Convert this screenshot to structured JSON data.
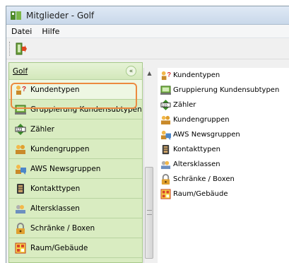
{
  "window": {
    "title": "Mitglieder - Golf"
  },
  "menu": {
    "items": [
      "Datei",
      "Hilfe"
    ]
  },
  "nav": {
    "header": "Golf",
    "items": [
      {
        "label": "Kundentypen",
        "icon": "kundentypen-icon"
      },
      {
        "label": "Gruppierung Kundensubtypen",
        "icon": "gruppierung-icon"
      },
      {
        "label": "Zähler",
        "icon": "zaehler-icon"
      },
      {
        "label": "Kundengruppen",
        "icon": "kundengruppen-icon"
      },
      {
        "label": "AWS Newsgruppen",
        "icon": "newsgruppen-icon"
      },
      {
        "label": "Kontakttypen",
        "icon": "kontakttypen-icon"
      },
      {
        "label": "Altersklassen",
        "icon": "altersklassen-icon"
      },
      {
        "label": "Schränke / Boxen",
        "icon": "schraenke-icon"
      },
      {
        "label": "Raum/Gebäude",
        "icon": "raum-icon"
      }
    ],
    "selected": "Kundentypen"
  },
  "tree": {
    "items": [
      {
        "label": "Kundentypen"
      },
      {
        "label": "Gruppierung Kundensubtypen"
      },
      {
        "label": "Zähler"
      },
      {
        "label": "Kundengruppen"
      },
      {
        "label": "AWS Newsgruppen"
      },
      {
        "label": "Kontakttypen"
      },
      {
        "label": "Altersklassen"
      },
      {
        "label": "Schränke / Boxen"
      },
      {
        "label": "Raum/Gebäude"
      }
    ]
  },
  "colors": {
    "nav_bg": "#d9ecc1",
    "selection": "#ec8a3f",
    "titlebar": "#c9d8ea"
  }
}
